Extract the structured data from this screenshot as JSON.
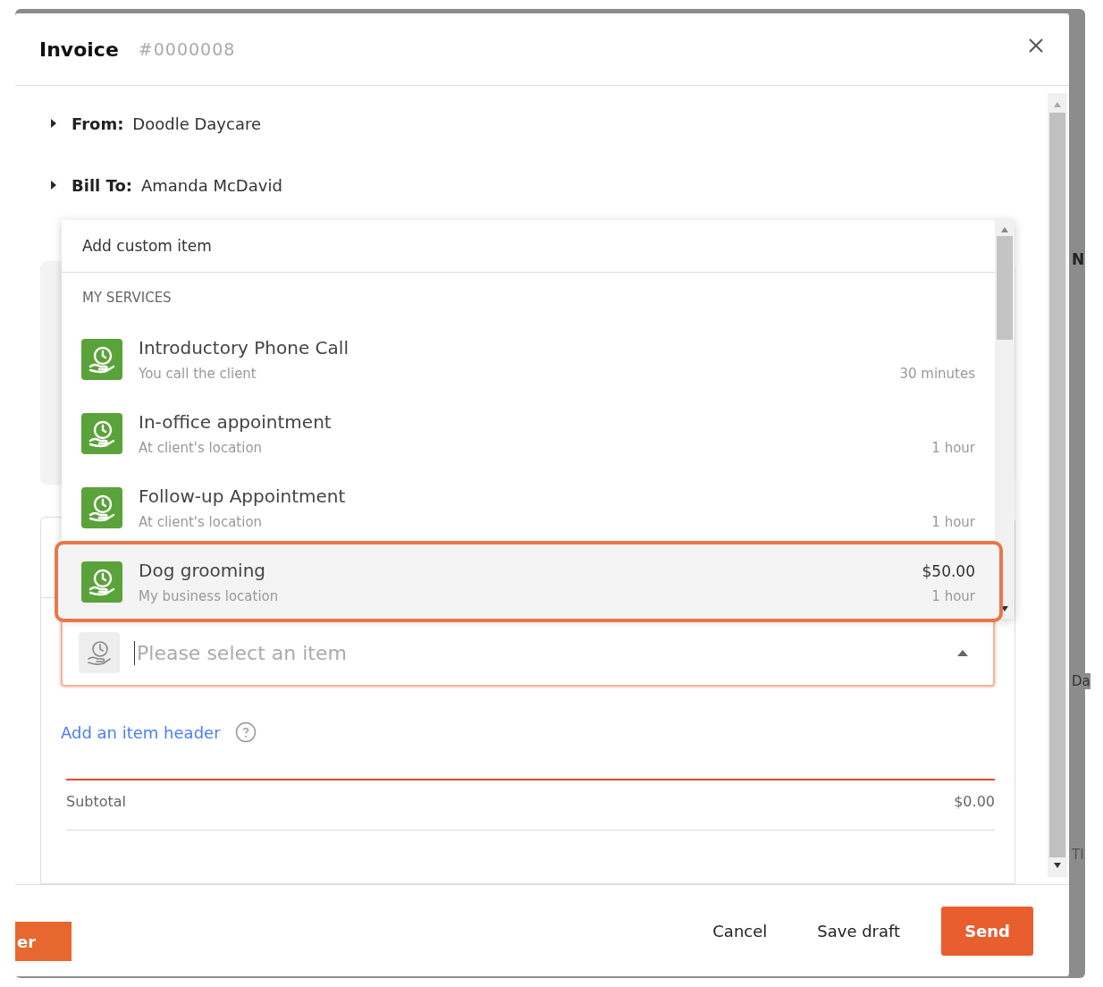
{
  "window": {
    "title": "Invoice",
    "number": "#0000008"
  },
  "sections": [
    {
      "label": "From:",
      "value": "Doodle Daycare",
      "expanded": false
    },
    {
      "label": "Bill To:",
      "value": "Amanda McDavid",
      "expanded": false
    }
  ],
  "dropdown": {
    "custom_item": "Add custom item",
    "group": "MY SERVICES",
    "items": [
      {
        "name": "Introductory Phone Call",
        "subtitle": "You call the client",
        "duration": "30 minutes",
        "selected": false
      },
      {
        "name": "In-office appointment",
        "subtitle": "At client's location",
        "duration": "1 hour",
        "selected": false
      },
      {
        "name": "Follow-up Appointment",
        "subtitle": "At client's location",
        "duration": "1 hour",
        "selected": false
      },
      {
        "name": "Dog grooming",
        "subtitle": "My business location",
        "price": "$50.00",
        "duration": "1 hour",
        "selected": true
      }
    ]
  },
  "item_select": {
    "placeholder": "Please select an item"
  },
  "add_header_link": "Add an item header",
  "subtotal": {
    "label": "Subtotal",
    "value": "$0.00"
  },
  "footer": {
    "buttons": [
      {
        "label": "Cancel",
        "kind": "plain"
      },
      {
        "label": "Save draft",
        "kind": "plain"
      },
      {
        "label": "Send",
        "kind": "primary"
      }
    ]
  },
  "background": {
    "button_fragment": "er",
    "right_fragments": [
      "N",
      "Da",
      "TI"
    ]
  }
}
